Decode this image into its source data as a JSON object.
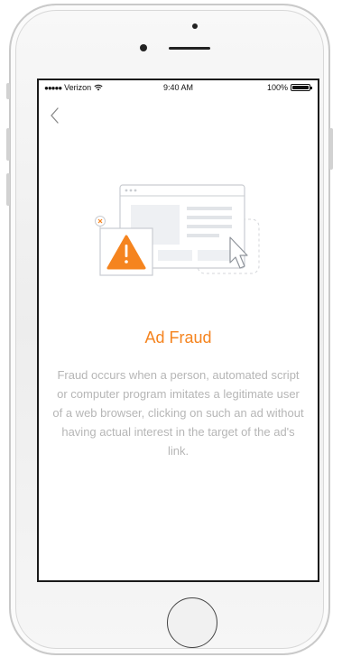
{
  "status_bar": {
    "signal_dots": "●●●●●",
    "carrier": "Verizon",
    "wifi_icon": "wifi-icon",
    "time": "9:40 AM",
    "battery_percent": "100%"
  },
  "nav": {
    "back_icon": "chevron-left-icon"
  },
  "illustration": {
    "icons": [
      "browser-window-icon",
      "warning-triangle-icon",
      "close-badge-icon",
      "mouse-cursor-icon"
    ]
  },
  "content": {
    "title": "Ad Fraud",
    "description": "Fraud occurs when a person, automated script or computer program imitates a legitimate user of a web browser, clicking on such an ad without having actual interest in the target of the ad's link."
  },
  "colors": {
    "accent": "#f5841f",
    "text_muted": "#b6b6b6",
    "illustration_line": "#c9ccd1",
    "illustration_fill": "#eef0f3"
  }
}
